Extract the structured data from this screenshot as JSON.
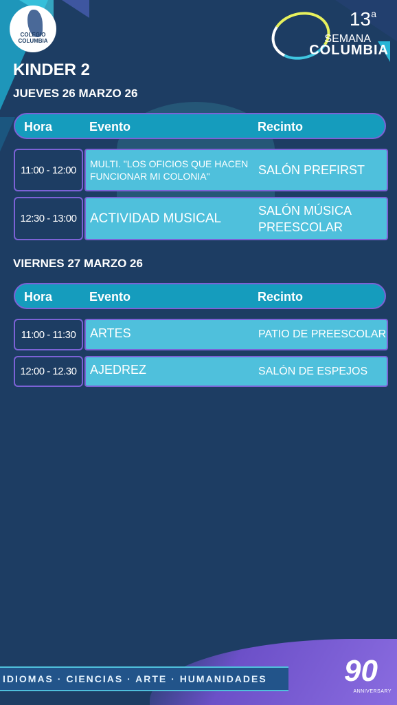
{
  "branding": {
    "school_logo_text": "COLEGIO COLUMBIA",
    "event_number": "13",
    "event_number_sup": "a",
    "event_word1": "SEMANA",
    "event_word2": "COLUMBIA"
  },
  "page_title": "KINDER 2",
  "columns": {
    "hora": "Hora",
    "evento": "Evento",
    "recinto": "Recinto"
  },
  "days": [
    {
      "date": "JUEVES 26 MARZO 26",
      "rows": [
        {
          "time": "11:00 - 12:00",
          "event": "MULTI. \"LOS OFICIOS QUE HACEN FUNCIONAR MI COLONIA\"",
          "venue": "SALÓN PREFIRST"
        },
        {
          "time": "12:30 - 13:00",
          "event": "ACTIVIDAD MUSICAL",
          "venue": "SALÓN MÚSICA PREESCOLAR"
        }
      ]
    },
    {
      "date": "VIERNES 27 MARZO 26",
      "rows": [
        {
          "time": "11:00 - 11:30",
          "event": "ARTES",
          "venue": "PATIO DE PREESCOLAR"
        },
        {
          "time": "12:00 - 12.30",
          "event": "AJEDREZ",
          "venue": "SALÓN DE ESPEJOS"
        }
      ]
    }
  ],
  "footer": {
    "banner": "IDIOMAS · CIENCIAS · ARTE · HUMANIDADES",
    "anniversary_number": "90",
    "anniversary_word": "ANNIVERSARY"
  }
}
